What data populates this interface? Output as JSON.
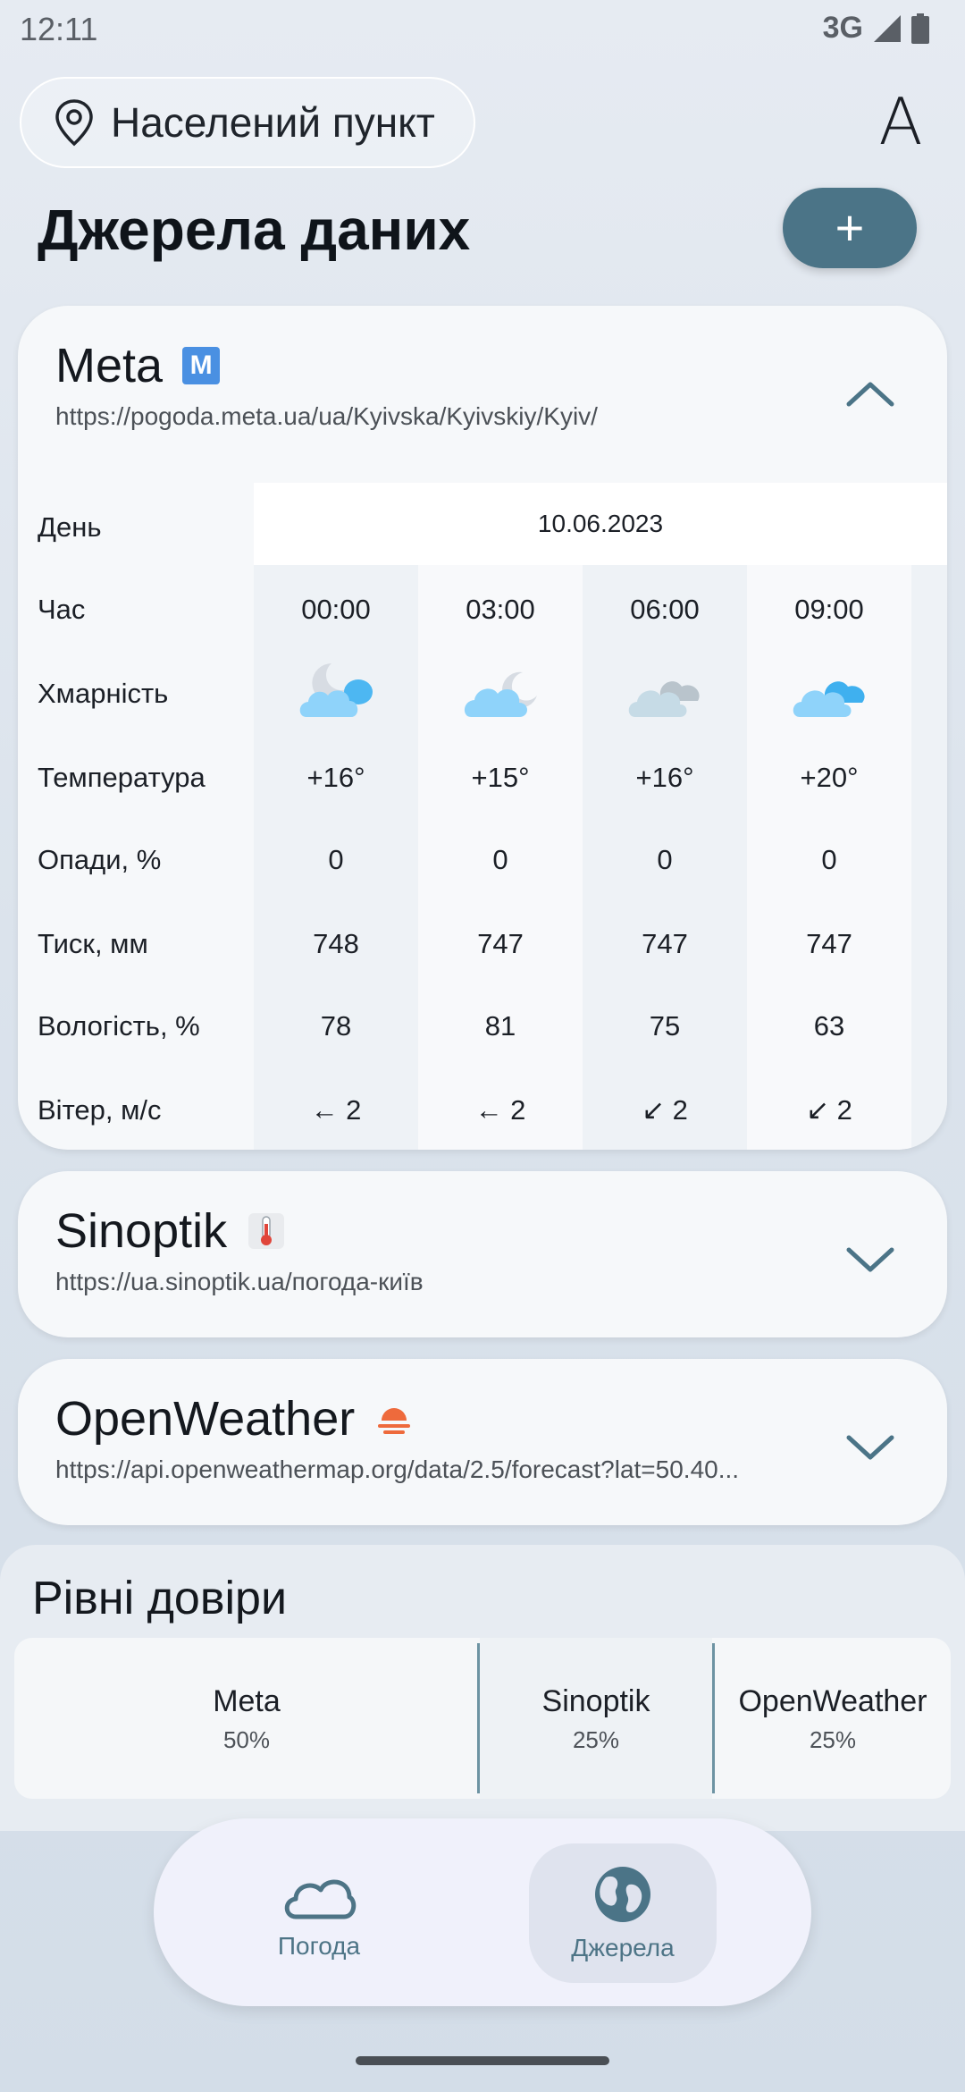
{
  "status": {
    "time": "12:11",
    "network": "3G"
  },
  "header": {
    "location_placeholder": "Населений пункт",
    "font_icon_glyph": "A",
    "page_title": "Джерела даних",
    "add_button": "+"
  },
  "sources": [
    {
      "name": "Meta",
      "badge": "M",
      "url": "https://pogoda.meta.ua/ua/Kyivska/Kyivskiy/Kyiv/",
      "expanded": true
    },
    {
      "name": "Sinoptik",
      "url": "https://ua.sinoptik.ua/погода-київ",
      "expanded": false
    },
    {
      "name": "OpenWeather",
      "url": "https://api.openweathermap.org/data/2.5/forecast?lat=50.40...",
      "expanded": false
    }
  ],
  "forecast": {
    "labels": {
      "day": "День",
      "time": "Час",
      "cloudiness": "Хмарність",
      "temperature": "Температура",
      "precip": "Опади, %",
      "pressure": "Тиск, мм",
      "humidity": "Вологість, %",
      "wind": "Вітер, м/с"
    },
    "date": "10.06.2023",
    "columns": [
      {
        "time": "00:00",
        "cloud_icon": "cloud-moon-icon",
        "temp": "+16°",
        "precip": "0",
        "pressure": "748",
        "humidity": "78",
        "wind": "← 2"
      },
      {
        "time": "03:00",
        "cloud_icon": "moon-cloud-icon",
        "temp": "+15°",
        "precip": "0",
        "pressure": "747",
        "humidity": "81",
        "wind": "← 2"
      },
      {
        "time": "06:00",
        "cloud_icon": "overcast-icon",
        "temp": "+16°",
        "precip": "0",
        "pressure": "747",
        "humidity": "75",
        "wind": "↙ 2"
      },
      {
        "time": "09:00",
        "cloud_icon": "cloud-icon",
        "temp": "+20°",
        "precip": "0",
        "pressure": "747",
        "humidity": "63",
        "wind": "↙ 2"
      }
    ]
  },
  "trust": {
    "title": "Рівні довіри",
    "items": [
      {
        "name": "Meta",
        "percent": "50%"
      },
      {
        "name": "Sinoptik",
        "percent": "25%"
      },
      {
        "name": "OpenWeather",
        "percent": "25%"
      }
    ]
  },
  "nav": {
    "items": [
      {
        "label": "Погода",
        "icon": "cloud-icon",
        "active": false
      },
      {
        "label": "Джерела",
        "icon": "globe-icon",
        "active": true
      }
    ]
  },
  "colors": {
    "accent": "#4b7487",
    "nav_label": "#4d7486",
    "divider": "#6d93a3"
  }
}
